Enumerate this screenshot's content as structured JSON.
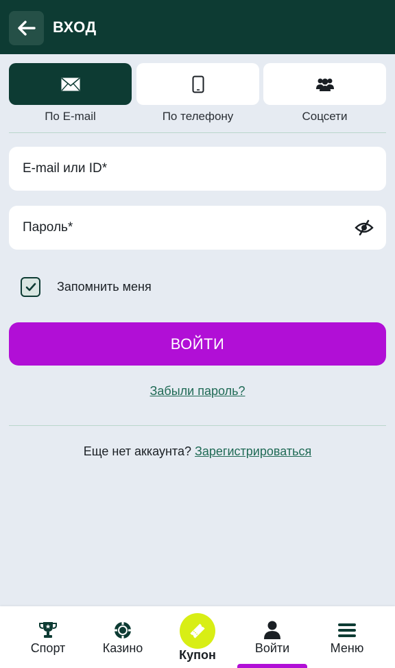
{
  "header": {
    "title": "ВХОД",
    "back_icon": "arrow-left-icon"
  },
  "tabs": [
    {
      "label": "По E-mail",
      "icon": "envelope-icon",
      "active": true
    },
    {
      "label": "По телефону",
      "icon": "phone-icon",
      "active": false
    },
    {
      "label": "Соцсети",
      "icon": "users-icon",
      "active": false
    }
  ],
  "form": {
    "email_placeholder": "E-mail или ID*",
    "email_value": "",
    "password_placeholder": "Пароль*",
    "password_value": "",
    "remember_label": "Запомнить меня",
    "remember_checked": true,
    "login_label": "ВОЙТИ",
    "forgot_label": "Забыли пароль?"
  },
  "register": {
    "prompt": "Еще нет аккаунта?",
    "link": "Зарегистрироваться"
  },
  "bottom_nav": [
    {
      "label": "Спорт",
      "icon": "trophy-icon"
    },
    {
      "label": "Казино",
      "icon": "casino-chip-icon"
    },
    {
      "label": "Купон",
      "icon": "ticket-icon"
    },
    {
      "label": "Войти",
      "icon": "user-icon"
    },
    {
      "label": "Меню",
      "icon": "menu-icon"
    }
  ],
  "colors": {
    "header_bg": "#0d3b33",
    "accent": "#b10fd6",
    "coupon": "#d8ee15",
    "link": "#1f6a55",
    "page_bg": "#e6ebf2"
  }
}
